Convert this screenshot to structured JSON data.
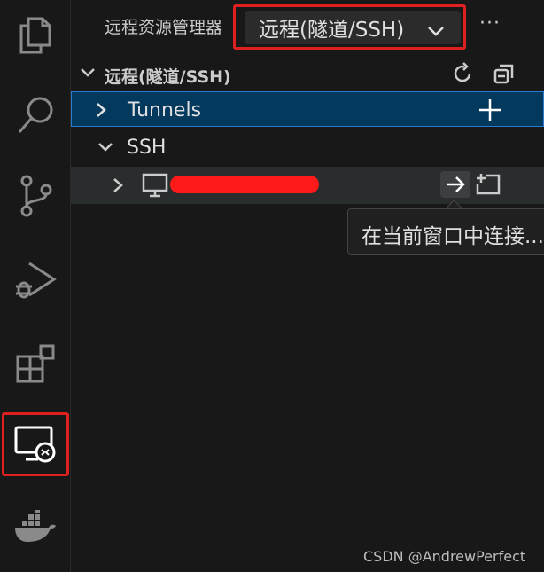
{
  "header": {
    "title": "远程资源管理器",
    "view_selector": "远程(隧道/SSH)",
    "more_label": "···"
  },
  "section": {
    "title": "远程(隧道/SSH)"
  },
  "tree": {
    "tunnels_label": "Tunnels",
    "ssh_label": "SSH"
  },
  "tooltip": {
    "text": "在当前窗口中连接..."
  },
  "watermark": "CSDN @AndrewPerfect",
  "colors": {
    "highlight_red": "#e02020",
    "selected_row": "#04395e",
    "accent": "#2a7bd0",
    "background": "#181818"
  },
  "icons": {
    "activity_bar": [
      "explorer-icon",
      "search-icon",
      "source-control-icon",
      "run-debug-icon",
      "extensions-icon",
      "remote-explorer-icon",
      "docker-icon"
    ]
  }
}
